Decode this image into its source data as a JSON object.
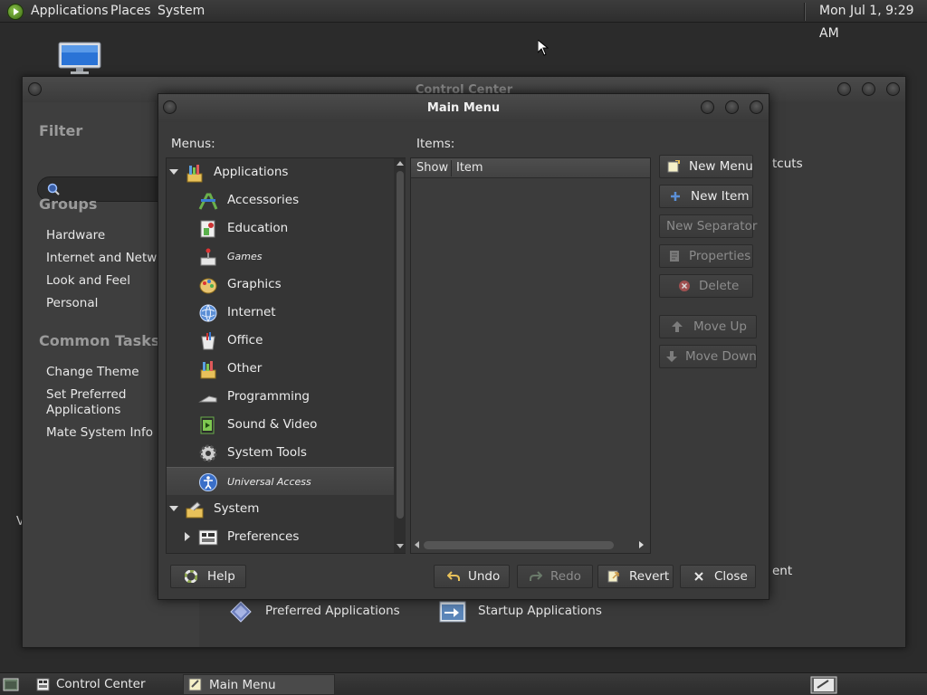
{
  "top_panel": {
    "menus": [
      "Applications",
      "Places",
      "System"
    ],
    "clock": "Mon Jul 1, 9:29 AM"
  },
  "desktop": {
    "stray_text": "V"
  },
  "control_center": {
    "title": "Control Center",
    "filter_heading": "Filter",
    "search_placeholder": "",
    "groups_heading": "Groups",
    "groups": [
      "Hardware",
      "Internet and Network",
      "Look and Feel",
      "Personal"
    ],
    "common_tasks_heading": "Common Tasks",
    "tasks": [
      "Change Theme",
      "Set Preferred Applications",
      "Mate System Info"
    ],
    "partial_text_right_1": "tcuts",
    "partial_text_right_2": "ent",
    "bottom_items": [
      "Preferred Applications",
      "Startup Applications"
    ]
  },
  "main_menu": {
    "title": "Main Menu",
    "menus_label": "Menus:",
    "items_label": "Items:",
    "columns": {
      "show": "Show",
      "item": "Item"
    },
    "tree": {
      "applications": "Applications",
      "accessories": "Accessories",
      "education": "Education",
      "games": "Games",
      "graphics": "Graphics",
      "internet": "Internet",
      "office": "Office",
      "other": "Other",
      "programming": "Programming",
      "sound_video": "Sound & Video",
      "system_tools": "System Tools",
      "universal_access": "Universal Access",
      "system": "System",
      "preferences": "Preferences"
    },
    "side_buttons": {
      "new_menu": "New Menu",
      "new_item": "New Item",
      "new_separator": "New Separator",
      "properties": "Properties",
      "delete": "Delete",
      "move_up": "Move Up",
      "move_down": "Move Down"
    },
    "bottom_buttons": {
      "help": "Help",
      "undo": "Undo",
      "redo": "Redo",
      "revert": "Revert",
      "close": "Close"
    }
  },
  "taskbar": {
    "tasks": [
      "Control Center",
      "Main Menu"
    ],
    "active_task": "Main Menu"
  },
  "colors": {
    "panel_bg": "#2e2e2e",
    "window_bg": "#3a3a3a",
    "selected_row": "#454545",
    "text": "#e6e6e6",
    "disabled_text": "#8c8c8c"
  }
}
